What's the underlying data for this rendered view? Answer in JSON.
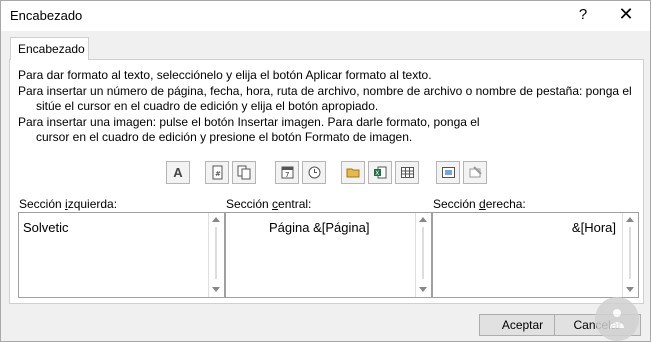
{
  "dialog": {
    "title": "Encabezado",
    "help_glyph": "?",
    "close_glyph": "✕"
  },
  "tab": {
    "label": "Encabezado"
  },
  "instructions": {
    "line1": "Para dar formato al texto, selecciónelo y elija el botón Aplicar formato al texto.",
    "line2": "Para insertar un número de página, fecha, hora, ruta de archivo, nombre de archivo o nombre de pestaña: ponga el",
    "line3": "sitúe el cursor en el cuadro de edición y elija el botón apropiado.",
    "line4": "Para insertar una imagen: pulse el botón Insertar imagen. Para darle formato, ponga el",
    "line5": "cursor en el cuadro de edición y presione el botón Formato de imagen."
  },
  "toolbar": {
    "format_text_glyph": "A",
    "icons": [
      "format-text-icon",
      "insert-page-number-icon",
      "insert-number-of-pages-icon",
      "insert-date-icon",
      "insert-time-icon",
      "insert-file-path-icon",
      "insert-file-name-icon",
      "insert-sheet-name-icon",
      "insert-picture-icon",
      "format-picture-icon"
    ]
  },
  "sections": {
    "left": {
      "label_pre": "Sección ",
      "label_u": "i",
      "label_post": "zquierda:",
      "content": "Solvetic"
    },
    "center": {
      "label_pre": "Sección ",
      "label_u": "c",
      "label_post": "entral:",
      "content": "Página &[Página]"
    },
    "right": {
      "label_pre": "Sección ",
      "label_u": "d",
      "label_post": "erecha:",
      "content": "&[Hora]"
    }
  },
  "buttons": {
    "accept": "Aceptar",
    "cancel": "Cancelar"
  },
  "colors": {
    "window_bg": "#f0f0f0",
    "button_bg": "#e1e1e1",
    "border": "#adadad"
  }
}
